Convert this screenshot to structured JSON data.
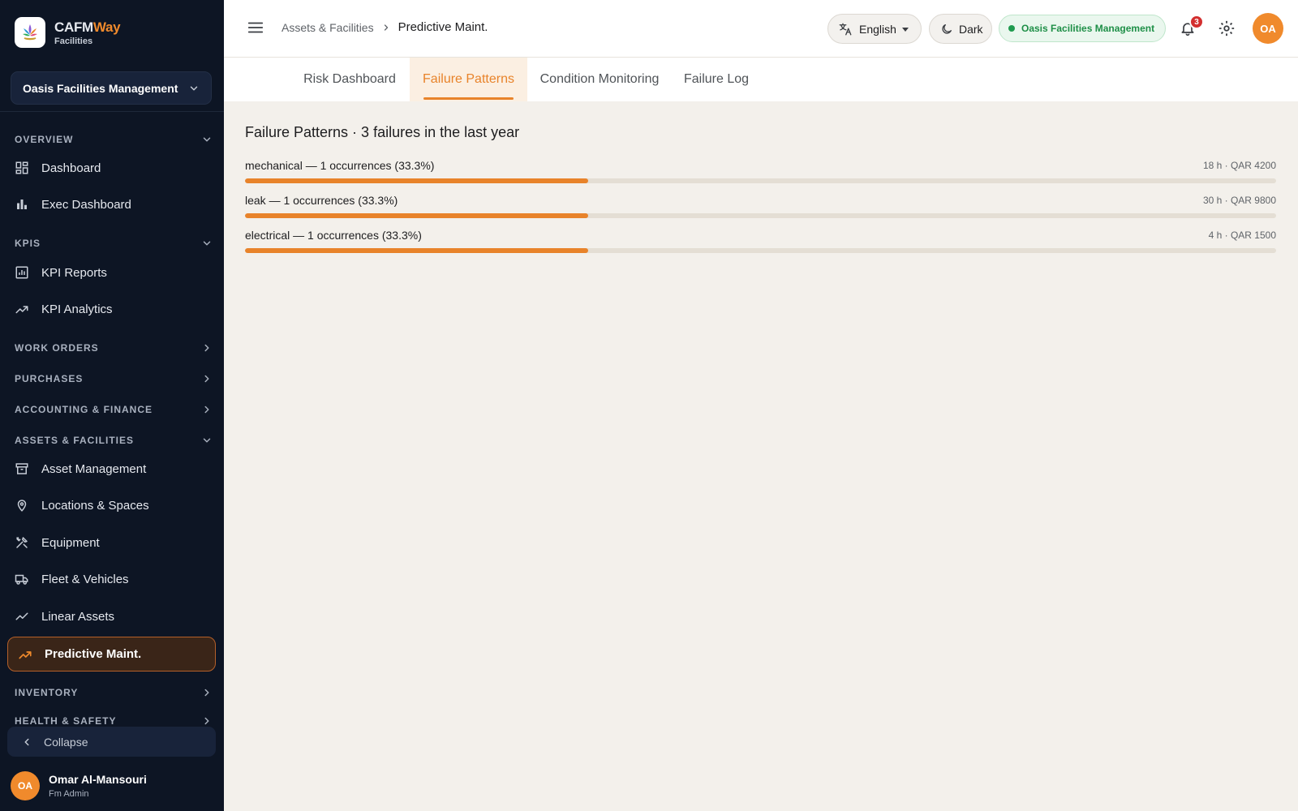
{
  "brand": {
    "name_main": "CAFM",
    "name_accent": "Way",
    "sub": "Facilities"
  },
  "org_selector": {
    "value": "Oasis Facilities Management"
  },
  "sidebar": {
    "sections": {
      "overview": "OVERVIEW",
      "kpis": "KPIS",
      "work_orders": "WORK ORDERS",
      "purchases": "PURCHASES",
      "accounting": "ACCOUNTING & FINANCE",
      "assets": "ASSETS & FACILITIES",
      "inventory": "INVENTORY",
      "health": "HEALTH & SAFETY"
    },
    "items": {
      "dashboard": "Dashboard",
      "exec_dashboard": "Exec Dashboard",
      "kpi_reports": "KPI Reports",
      "kpi_analytics": "KPI Analytics",
      "asset_management": "Asset Management",
      "locations": "Locations & Spaces",
      "equipment": "Equipment",
      "fleet": "Fleet & Vehicles",
      "linear_assets": "Linear Assets",
      "predictive": "Predictive Maint."
    },
    "collapse_label": "Collapse",
    "user": {
      "initials": "OA",
      "name": "Omar Al-Mansouri",
      "role": "Fm Admin"
    }
  },
  "topbar": {
    "breadcrumb": {
      "parent": "Assets & Facilities",
      "current": "Predictive Maint."
    },
    "language": "English",
    "theme": "Dark",
    "org_badge": "Oasis Facilities Management",
    "notification_count": "3",
    "avatar_initials": "OA"
  },
  "tabs": [
    "Risk Dashboard",
    "Failure Patterns",
    "Condition Monitoring",
    "Failure Log"
  ],
  "active_tab": "Failure Patterns",
  "content": {
    "title": "Failure Patterns · 3 failures in the last year",
    "patterns": [
      {
        "label": "mechanical — 1 occurrences (33.3%)",
        "stats": "18 h · QAR 4200",
        "share": 0.333
      },
      {
        "label": "leak — 1 occurrences (33.3%)",
        "stats": "30 h · QAR 9800",
        "share": 0.333
      },
      {
        "label": "electrical — 1 occurrences (33.3%)",
        "stats": "4 h · QAR 1500",
        "share": 0.333
      }
    ]
  },
  "colors": {
    "accent": "#e8832a",
    "sidebar_bg": "#0d1524",
    "success": "#1e8f47",
    "danger": "#d32f2f"
  }
}
